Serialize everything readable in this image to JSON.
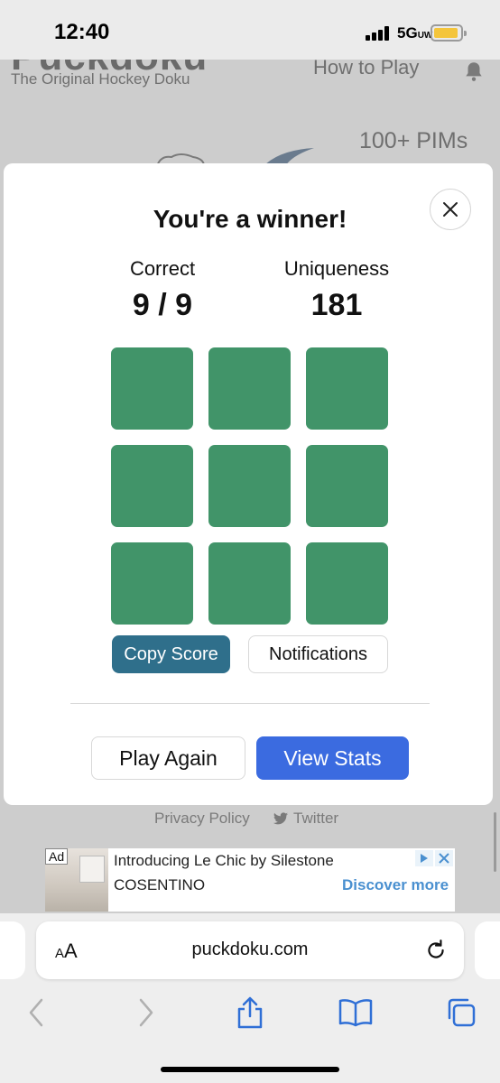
{
  "status_bar": {
    "time": "12:40",
    "network": "5GUW"
  },
  "site": {
    "logo": "Puckdoku",
    "tagline": "The Original Hockey Doku",
    "nav_how_to_play": "How to Play",
    "category_text": "100+ PIMs"
  },
  "modal": {
    "title": "You're a winner!",
    "correct_label": "Correct",
    "correct_value": "9 / 9",
    "uniqueness_label": "Uniqueness",
    "uniqueness_value": "181",
    "grid_color": "#419469",
    "grid_cells": [
      {
        "row": 1,
        "col": 1,
        "status": "correct"
      },
      {
        "row": 1,
        "col": 2,
        "status": "correct"
      },
      {
        "row": 1,
        "col": 3,
        "status": "correct"
      },
      {
        "row": 2,
        "col": 1,
        "status": "correct"
      },
      {
        "row": 2,
        "col": 2,
        "status": "correct"
      },
      {
        "row": 2,
        "col": 3,
        "status": "correct"
      },
      {
        "row": 3,
        "col": 1,
        "status": "correct"
      },
      {
        "row": 3,
        "col": 2,
        "status": "correct"
      },
      {
        "row": 3,
        "col": 3,
        "status": "correct"
      }
    ],
    "copy_score_label": "Copy Score",
    "notifications_label": "Notifications",
    "play_again_label": "Play Again",
    "view_stats_label": "View Stats"
  },
  "footer": {
    "privacy": "Privacy Policy",
    "twitter": "Twitter"
  },
  "ad": {
    "badge": "Ad",
    "headline": "Introducing Le Chic by Silestone",
    "brand": "COSENTINO",
    "cta": "Discover more"
  },
  "browser": {
    "text_size_label": "AA",
    "url": "puckdoku.com"
  },
  "colors": {
    "accent_blue": "#3b6be0",
    "copy_button": "#2f6f8b",
    "battery": "#f4c53b"
  }
}
